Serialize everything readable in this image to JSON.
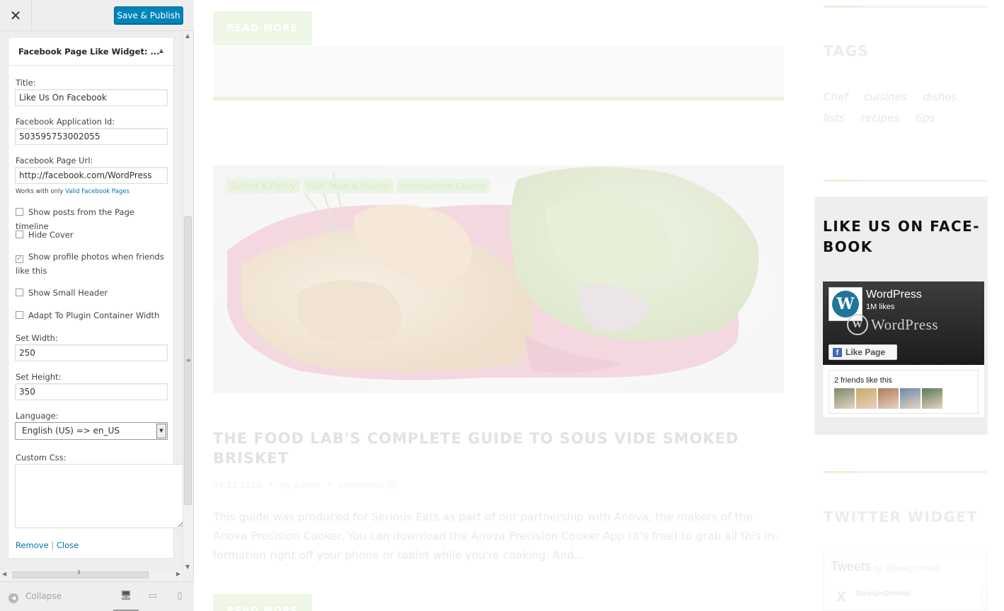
{
  "customizer": {
    "close_icon": "close-icon",
    "save_label": "Save & Publish",
    "widget": {
      "title": "Facebook Page Like Widget: ...",
      "fields": {
        "title_label": "Title:",
        "title_value": "Like Us On Facebook",
        "app_id_label": "Facebook Application Id:",
        "app_id_value": "503595753002055",
        "page_url_label": "Facebook Page Url:",
        "page_url_value": "http://facebook.com/WordPress",
        "page_url_help_prefix": "Works with only",
        "page_url_help_link": "Valid Facebook Pages",
        "show_posts_label": "Show posts from the Page timeline",
        "show_posts_checked": false,
        "hide_cover_label": "Hide Cover",
        "hide_cover_checked": false,
        "show_faces_label": "Show profile photos when friends like this",
        "show_faces_checked": true,
        "small_header_label": "Show Small Header",
        "small_header_checked": false,
        "adapt_width_label": "Adapt To Plugin Container Width",
        "adapt_width_checked": false,
        "width_label": "Set Width:",
        "width_value": "250",
        "height_label": "Set Height:",
        "height_value": "350",
        "language_label": "Language:",
        "language_value": "English (US) => en_US",
        "custom_css_label": "Custom Css:",
        "custom_css_value": ""
      },
      "remove_label": "Remove",
      "separator": "|",
      "close_label": "Close"
    },
    "footer": {
      "collapse_label": "Collapse",
      "devices": [
        "desktop-icon",
        "tablet-icon",
        "mobile-icon"
      ]
    }
  },
  "preview": {
    "read_more_label": "READ MORE",
    "post": {
      "categories": [
        "Baking & Pastry",
        "Fish, Meat & Poultry",
        "International Cuisine"
      ],
      "title": "THE FOOD LAB'S COMPLETE GUIDE TO SOUS VIDE SMOKED BRISKET",
      "date": "04.21.2016",
      "bullet": "•",
      "author": "by admin",
      "comments": "comments (0)",
      "excerpt": "This guide was produced for Serious Eats as part of our partnership with Anova, the makers of the Anova Precision Cooker. You can download the Anova Precision Cooker App (it's free) to grab all this in-formation right off your phone or tablet while you're cooking. And..."
    },
    "sidebar": {
      "tags_heading": "TAGS",
      "tags": [
        "Chef",
        "cuisines",
        "dishes",
        "lists",
        "recipes",
        "tips"
      ],
      "fb_widget_title": "LIKE US ON FACE-BOOK",
      "fb": {
        "page_name": "WordPress",
        "likes": "1M likes",
        "wordmark": "WordPress",
        "like_button": "Like Page",
        "friends_text": "2 friends like this",
        "face_count": 5
      },
      "twitter_heading": "TWITTER WIDGET",
      "twitter": {
        "header": "Tweets",
        "by": "by @DesignOrbital",
        "user": "DesignOrbital"
      }
    }
  },
  "colors": {
    "accent": "#0085ba",
    "link": "#0073aa",
    "fb_blue": "#4267b2",
    "green_tint": "#e8f5dc"
  }
}
